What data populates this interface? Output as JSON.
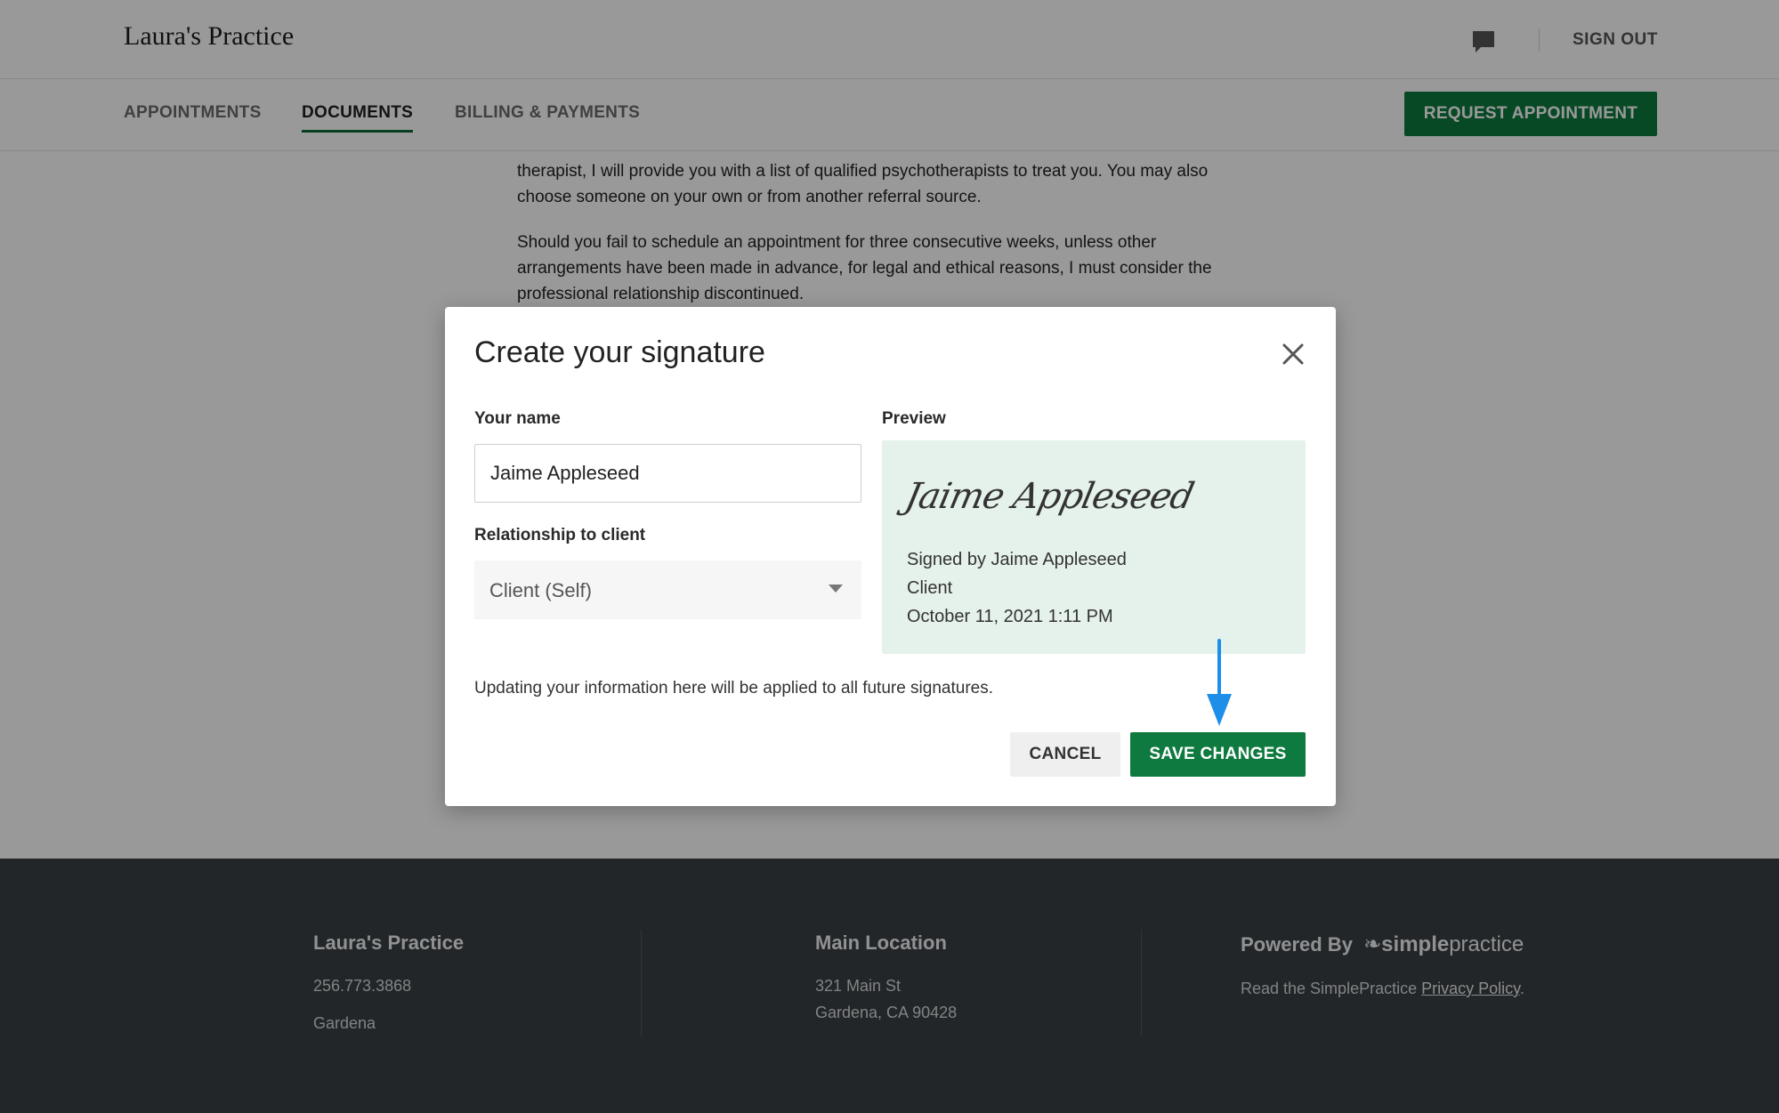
{
  "header": {
    "brand": "Laura's Practice",
    "chat_icon": "chat-bubble-icon",
    "sign_out": "SIGN OUT"
  },
  "nav": {
    "items": [
      {
        "label": "APPOINTMENTS",
        "active": false
      },
      {
        "label": "DOCUMENTS",
        "active": true
      },
      {
        "label": "BILLING & PAYMENTS",
        "active": false
      }
    ],
    "request_button": "REQUEST APPOINTMENT"
  },
  "document": {
    "paragraphs": [
      "therapist, I will provide you with a list of qualified psychotherapists to treat you. You may also choose someone on your own or from another referral source.",
      "Should you fail to schedule an appointment for three consecutive weeks, unless other arrangements have been made in advance, for legal and ethical reasons, I must consider the professional relationship discontinued."
    ]
  },
  "modal": {
    "title": "Create your signature",
    "close_icon": "close-icon",
    "name_label": "Your name",
    "name_value": "Jaime Appleseed",
    "relationship_label": "Relationship to client",
    "relationship_value": "Client (Self)",
    "preview_label": "Preview",
    "preview": {
      "signature": "Jaime Appleseed",
      "signed_by": "Signed by Jaime Appleseed",
      "role": "Client",
      "timestamp": "October 11, 2021 1:11 PM"
    },
    "note": "Updating your information here will be applied to all future signatures.",
    "cancel": "CANCEL",
    "save": "SAVE CHANGES"
  },
  "footer": {
    "practice": {
      "title": "Laura's Practice",
      "phone": "256.773.3868",
      "city": "Gardena"
    },
    "location": {
      "title": "Main Location",
      "street": "321 Main St",
      "city_zip": "Gardena, CA 90428"
    },
    "powered": {
      "label": "Powered By",
      "logo_bold": "simple",
      "logo_light": "practice",
      "policy_prefix": "Read the SimplePractice",
      "policy_link": "Privacy Policy",
      "policy_suffix": "."
    }
  },
  "colors": {
    "brand_green": "#0e7a3f",
    "preview_bg": "#e5f1eb",
    "footer_bg": "#3a4045",
    "arrow_blue": "#1e8fe8"
  }
}
